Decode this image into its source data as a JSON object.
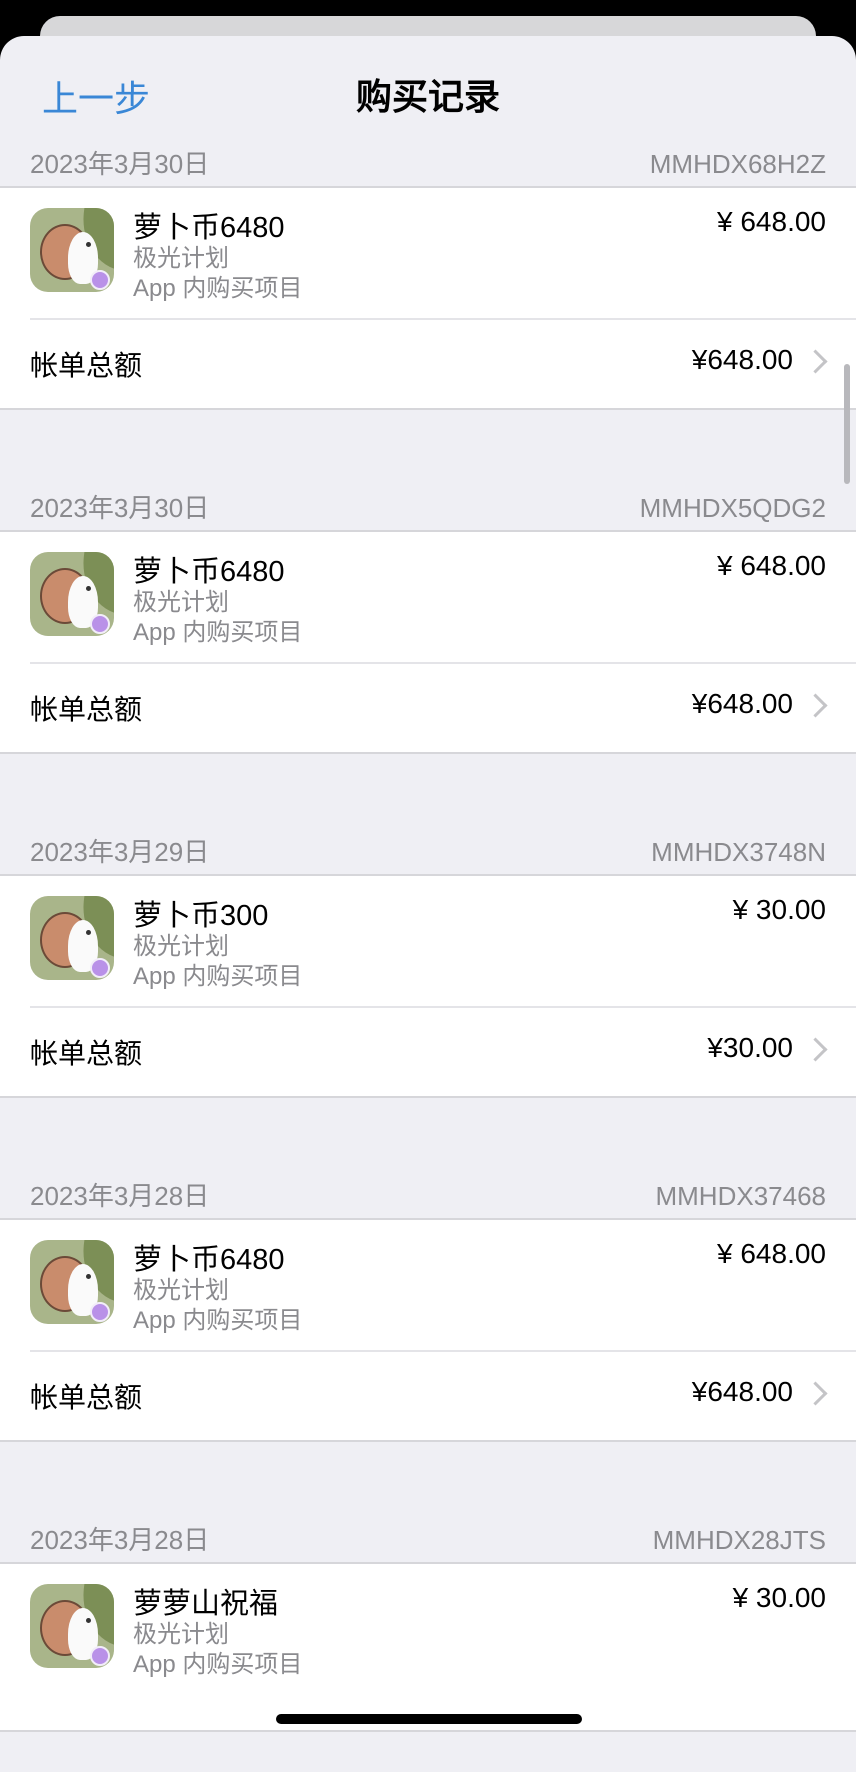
{
  "nav": {
    "back_label": "上一步",
    "title": "购买记录"
  },
  "records": [
    {
      "date": "2023年3月30日",
      "order_id": "MMHDX68H2Z",
      "item_name": "萝卜币6480",
      "developer": "极光计划",
      "item_type": "App 内购买项目",
      "price": "¥ 648.00",
      "total_label": "帐单总额",
      "total_amount": "¥648.00"
    },
    {
      "date": "2023年3月30日",
      "order_id": "MMHDX5QDG2",
      "item_name": "萝卜币6480",
      "developer": "极光计划",
      "item_type": "App 内购买项目",
      "price": "¥ 648.00",
      "total_label": "帐单总额",
      "total_amount": "¥648.00"
    },
    {
      "date": "2023年3月29日",
      "order_id": "MMHDX3748N",
      "item_name": "萝卜币300",
      "developer": "极光计划",
      "item_type": "App 内购买项目",
      "price": "¥ 30.00",
      "total_label": "帐单总额",
      "total_amount": "¥30.00"
    },
    {
      "date": "2023年3月28日",
      "order_id": "MMHDX37468",
      "item_name": "萝卜币6480",
      "developer": "极光计划",
      "item_type": "App 内购买项目",
      "price": "¥ 648.00",
      "total_label": "帐单总额",
      "total_amount": "¥648.00"
    },
    {
      "date": "2023年3月28日",
      "order_id": "MMHDX28JTS",
      "item_name": "萝萝山祝福",
      "developer": "极光计划",
      "item_type": "App 内购买项目",
      "price": "¥ 30.00"
    }
  ],
  "icons": {
    "app_icon": "app-icon",
    "chevron": "chevron-right-icon"
  },
  "colors": {
    "accent": "#3a87d6",
    "background": "#efeff4",
    "secondary_text": "#8a8a8e"
  }
}
